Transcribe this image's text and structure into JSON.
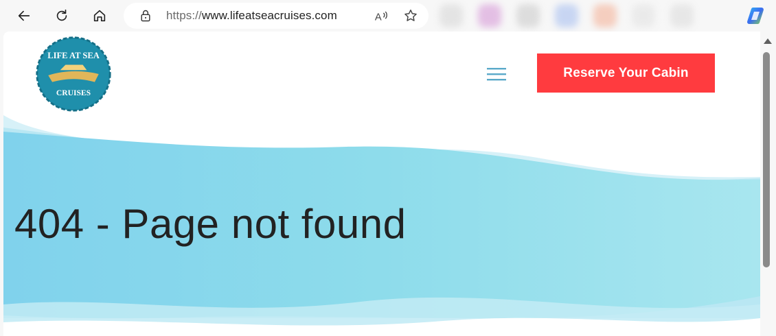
{
  "browser": {
    "url_scheme": "https://",
    "url_host": "www.lifeatseacruises.com",
    "icons": [
      "back-icon",
      "reload-icon",
      "home-icon",
      "lock-icon",
      "read-aloud-icon",
      "favorite-star-icon",
      "copilot-icon"
    ],
    "extension_colors": [
      "#d8d8d8",
      "#d79ad8",
      "#cccccc",
      "#a9c0f0",
      "#f4b39a",
      "#e3e3e3",
      "#dddddd",
      "#bfe0bf"
    ]
  },
  "header": {
    "logo_text_top": "LIFE AT SEA",
    "logo_text_bottom": "CRUISES",
    "menu_icon": "hamburger-menu-icon",
    "reserve_label": "Reserve Your Cabin"
  },
  "main": {
    "title": "404 - Page not found"
  },
  "colors": {
    "accent_red": "#ff3b3f",
    "wave_blue": "#8fdcec",
    "logo_teal": "#1f8fab",
    "menu_blue": "#5aa9c9"
  }
}
